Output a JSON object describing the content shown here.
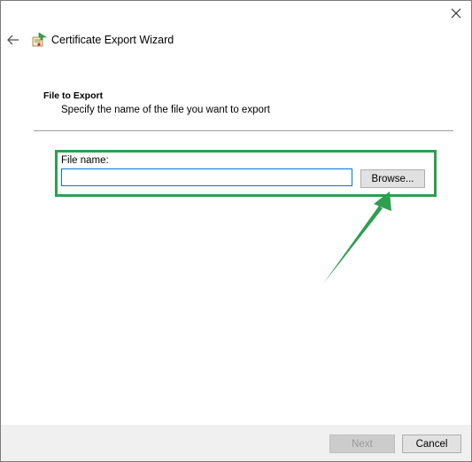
{
  "window": {
    "close_icon": "close-icon"
  },
  "header": {
    "back_icon": "back-arrow-icon",
    "wizard_icon": "certificate-icon",
    "title": "Certificate Export Wizard"
  },
  "section": {
    "title": "File to Export",
    "description": "Specify the name of the file you want to export"
  },
  "file": {
    "label": "File name:",
    "value": "",
    "browse_label": "Browse..."
  },
  "annotation": {
    "color": "#2e9e4f"
  },
  "footer": {
    "next_label": "Next",
    "cancel_label": "Cancel"
  }
}
